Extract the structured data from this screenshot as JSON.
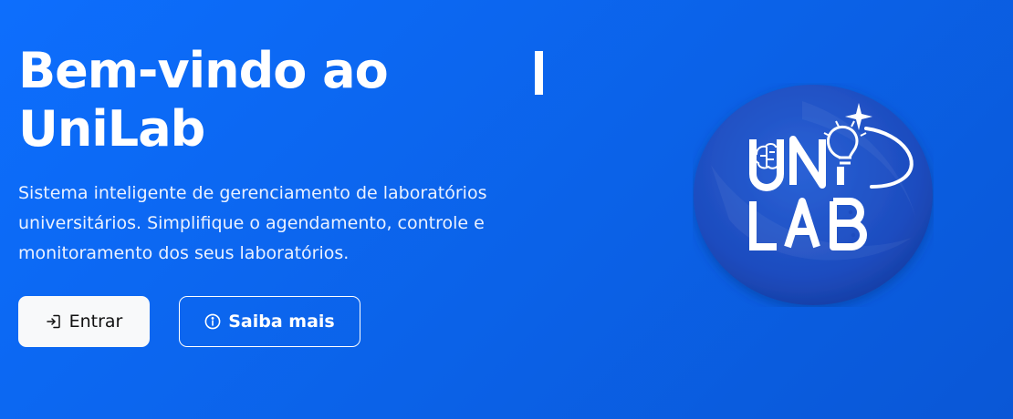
{
  "hero": {
    "title_line1": "Bem-vindo ao",
    "title_line2": "UniLab",
    "description": "Sistema inteligente de gerenciamento de laboratórios universitários. Simplifique o agendamento, controle e monitoramento dos seus laboratórios.",
    "buttons": {
      "login_label": "Entrar",
      "login_icon": "login-icon",
      "info_label": "Saiba mais",
      "info_icon": "info-circle-icon"
    }
  },
  "logo": {
    "name": "UniLab",
    "icons": [
      "brain-icon",
      "lightbulb-icon",
      "sparkle-icon"
    ]
  },
  "colors": {
    "background": "#0d6efd",
    "logo_circle": "#1f4fc4",
    "button_primary_bg": "#f8f9fa",
    "text": "#ffffff"
  }
}
